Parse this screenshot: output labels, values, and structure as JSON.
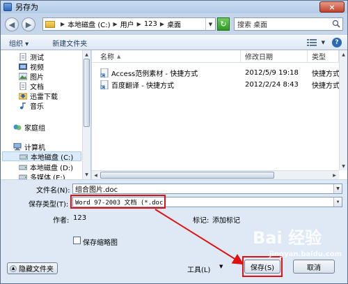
{
  "window": {
    "title": "另存为",
    "close_label": "×"
  },
  "address": {
    "crumbs": [
      "本地磁盘 (C:)",
      "用户",
      "123",
      "桌面"
    ],
    "search_placeholder": "搜索 桌面",
    "back": "◀",
    "forward": "▶"
  },
  "toolbar": {
    "organize": "组织 ▾",
    "new_folder": "新建文件夹"
  },
  "nav": {
    "items": [
      {
        "label": "测试",
        "icon": "document-icon"
      },
      {
        "label": "视频",
        "icon": "video-icon"
      },
      {
        "label": "图片",
        "icon": "picture-icon"
      },
      {
        "label": "文档",
        "icon": "document-icon"
      },
      {
        "label": "迅雷下载",
        "icon": "download-icon"
      },
      {
        "label": "音乐",
        "icon": "music-icon"
      },
      {
        "label": "家庭组",
        "icon": "homegroup-icon"
      },
      {
        "label": "计算机",
        "icon": "computer-icon"
      },
      {
        "label": "本地磁盘 (C:)",
        "icon": "drive-icon"
      },
      {
        "label": "本地磁盘 (D:)",
        "icon": "drive-icon"
      },
      {
        "label": "多媒体 (E:)",
        "icon": "drive-icon"
      }
    ]
  },
  "files": {
    "columns": [
      "名称",
      "修改日期",
      "类型"
    ],
    "rows": [
      {
        "name": "Access范例素材 - 快捷方式",
        "date": "2012/5/9 19:18",
        "type": "快捷方式"
      },
      {
        "name": "百度翻译 - 快捷方式",
        "date": "2012/2/24 8:43",
        "type": "快捷方式"
      }
    ]
  },
  "form": {
    "filename_label": "文件名(N):",
    "filename_value": "组合图片.doc",
    "savetype_label": "保存类型(T):",
    "savetype_value": "Word 97-2003 文档 (*.doc)",
    "author_label": "作者:",
    "author_value": "123",
    "tags_label": "标记:",
    "tags_value": "添加标记",
    "thumbnail_label": "保存缩略图",
    "hide_folders": "隐藏文件夹",
    "tools": "工具(L)",
    "save": "保存(S)",
    "cancel": "取消"
  },
  "watermark": {
    "text": "Bai 经验",
    "url": "jingyan.baidu.com"
  },
  "colors": {
    "highlight": "#e01010",
    "accent": "#2d69b5"
  }
}
